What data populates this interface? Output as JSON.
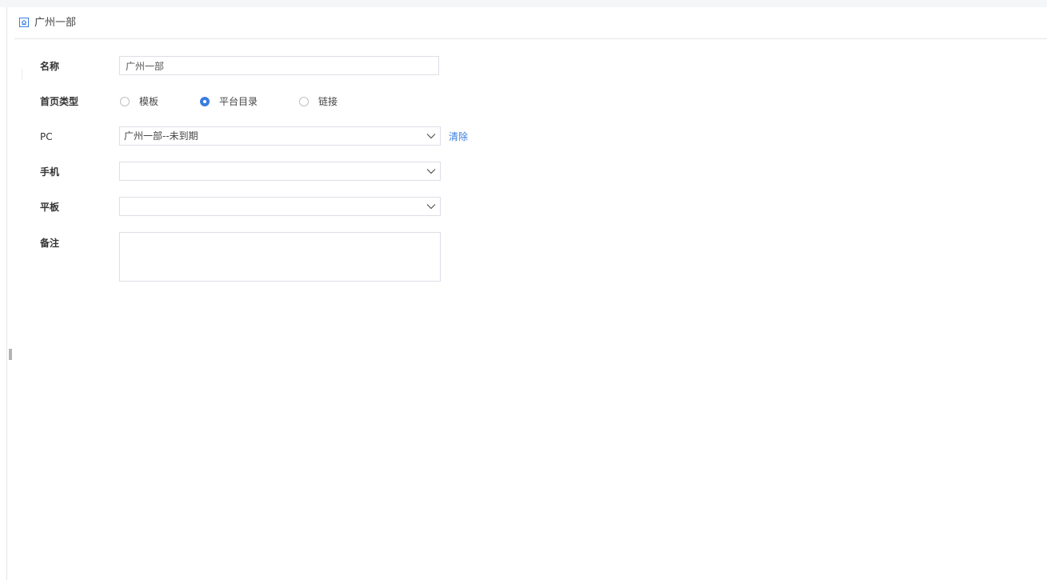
{
  "header": {
    "title": "广州一部",
    "icon": "home-icon"
  },
  "form": {
    "name": {
      "label": "名称",
      "value": "广州一部"
    },
    "home_type": {
      "label": "首页类型",
      "options": [
        {
          "label": "模板",
          "checked": false
        },
        {
          "label": "平台目录",
          "checked": true
        },
        {
          "label": "链接",
          "checked": false
        }
      ]
    },
    "pc": {
      "label": "PC",
      "value": "广州一部--未到期",
      "clear_label": "清除"
    },
    "mobile": {
      "label": "手机",
      "value": ""
    },
    "tablet": {
      "label": "平板",
      "value": ""
    },
    "remark": {
      "label": "备注",
      "value": ""
    }
  },
  "colors": {
    "accent": "#3a7de0",
    "border": "#dcdfe6",
    "top_strip": "#f5f6f8"
  }
}
